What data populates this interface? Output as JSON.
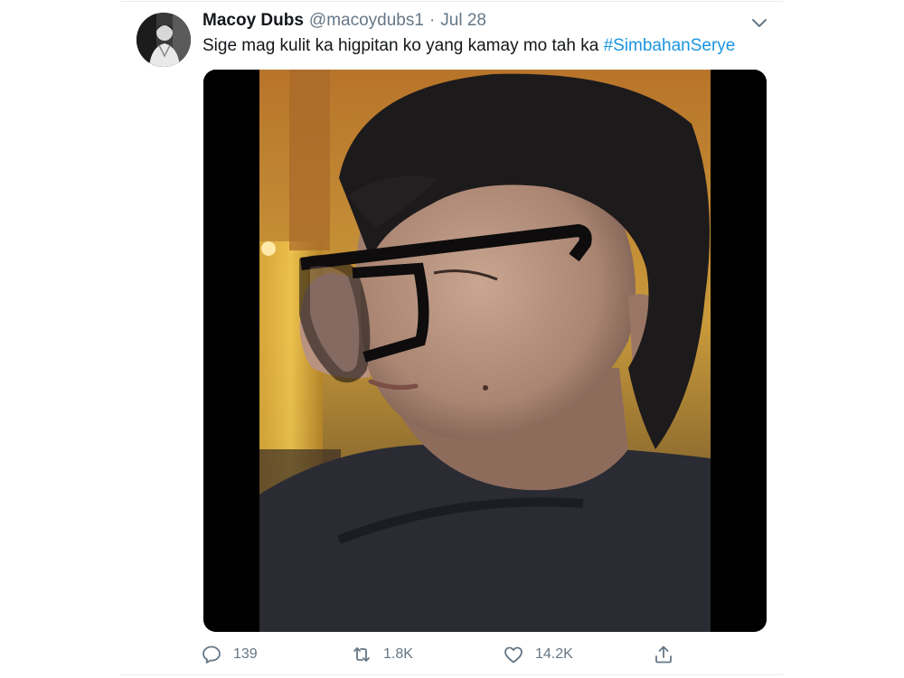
{
  "tweet": {
    "author_name": "Macoy Dubs",
    "handle": "@macoydubs1",
    "separator": "·",
    "date": "Jul 28",
    "text": "Sige mag kulit ka higpitan ko yang kamay mo tah ka",
    "hashtag": "#SimbahanSerye"
  },
  "actions": {
    "replies": "139",
    "retweets": "1.8K",
    "likes": "14.2K"
  },
  "icons": {
    "menu": "chevron-down-icon",
    "reply": "reply-icon",
    "retweet": "retweet-icon",
    "like": "heart-icon",
    "share": "share-icon"
  },
  "colors": {
    "text": "#14171a",
    "secondary": "#657786",
    "link": "#1b95e0",
    "divider": "#e6ecf0"
  }
}
